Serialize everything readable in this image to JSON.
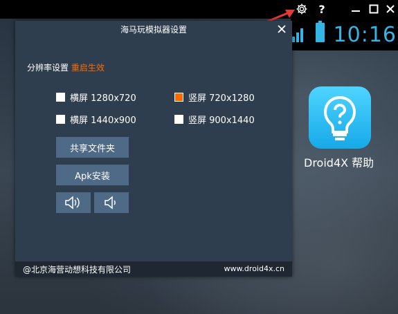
{
  "window": {
    "controls": {
      "settings_icon": "gear-icon",
      "help_label": "?",
      "minimize_icon": "minimize-icon",
      "maximize_icon": "maximize-icon",
      "close_icon": "close-icon"
    }
  },
  "status_bar": {
    "clock": "10:16",
    "accent_color": "#33b5e5"
  },
  "desktop": {
    "apps": [
      {
        "label": "Droid4X 帮助",
        "icon": "help-bulb-icon"
      }
    ]
  },
  "dialog": {
    "title": "海马玩模拟器设置",
    "resolution_heading": "分辨率设置",
    "resolution_note": "重启生效",
    "options": [
      {
        "label": "横屏 1280x720",
        "checked": false
      },
      {
        "label": "竖屏 720x1280",
        "checked": true
      },
      {
        "label": "横屏 1440x900",
        "checked": false
      },
      {
        "label": "竖屏 900x1440",
        "checked": false
      }
    ],
    "buttons": {
      "shared_folder": "共享文件夹",
      "apk_install": "Apk安装",
      "volume_up_icon": "volume-up-icon",
      "volume_down_icon": "volume-down-icon"
    },
    "footer": {
      "copyright": "@北京海营动想科技有限公司",
      "website": "www.droid4x.cn"
    },
    "colors": {
      "panel": "#2f3e4f",
      "button": "#4e6a86",
      "accent": "#ff6a00"
    }
  }
}
